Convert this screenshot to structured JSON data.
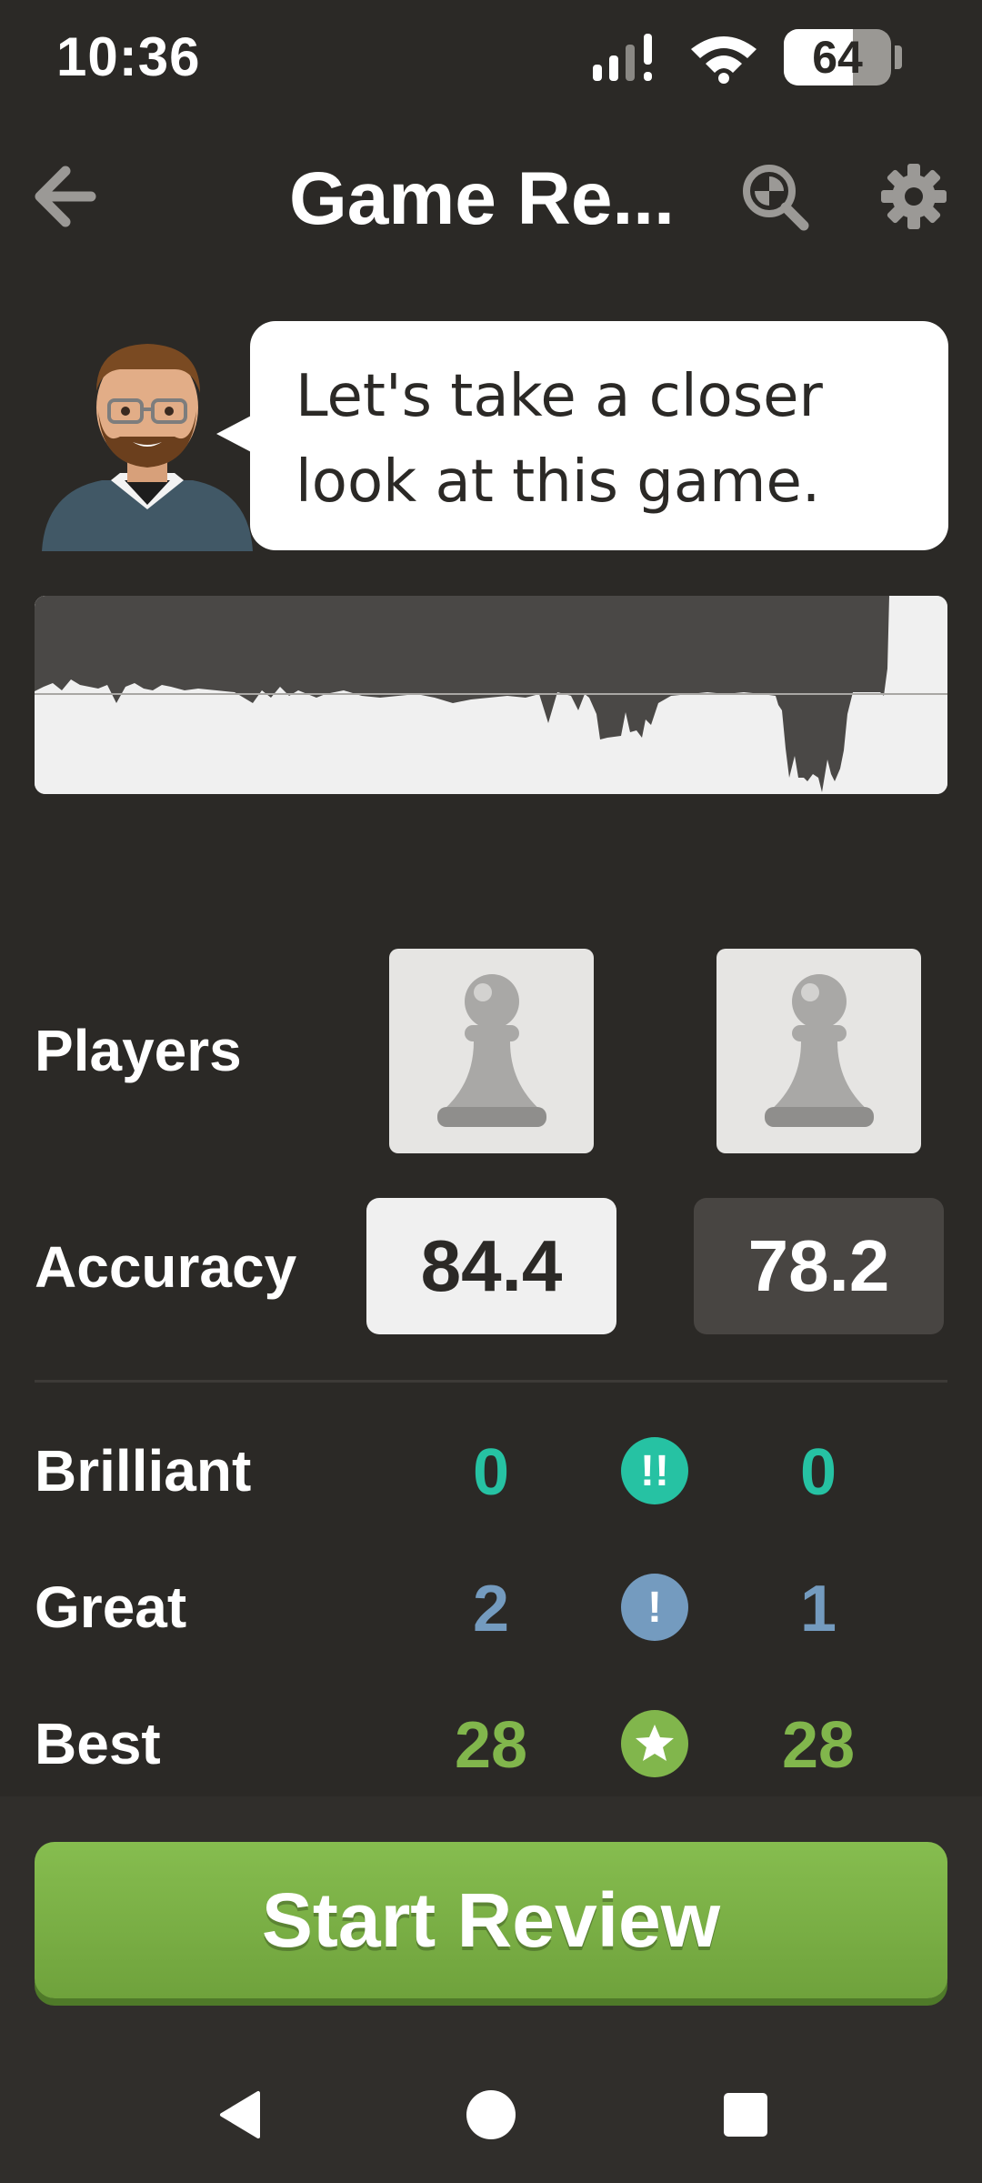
{
  "status_bar": {
    "time": "10:36",
    "battery": "64",
    "battery_level": 0.64
  },
  "app_bar": {
    "title": "Game Re...",
    "icons": [
      "back-arrow-icon",
      "magnifier-analysis-icon",
      "gear-icon"
    ]
  },
  "coach": {
    "message_line1": "Let's take a closer",
    "message_line2": "look at this game."
  },
  "players": {
    "label": "Players"
  },
  "accuracy": {
    "label": "Accuracy",
    "white": "84.4",
    "black": "78.2"
  },
  "stats": [
    {
      "label": "Brilliant",
      "white": "0",
      "black": "0",
      "icon": "!!",
      "color": "#26c2a3"
    },
    {
      "label": "Great",
      "white": "2",
      "black": "1",
      "icon": "!",
      "color": "#749bbf"
    },
    {
      "label": "Best",
      "white": "28",
      "black": "28",
      "icon": "star-icon",
      "color": "#81b64c"
    }
  ],
  "start_button": {
    "label": "Start Review",
    "color": "#81b64c"
  },
  "nav_bar": {
    "icons": [
      "nav-back-icon",
      "nav-home-icon",
      "nav-recents-icon"
    ]
  }
}
